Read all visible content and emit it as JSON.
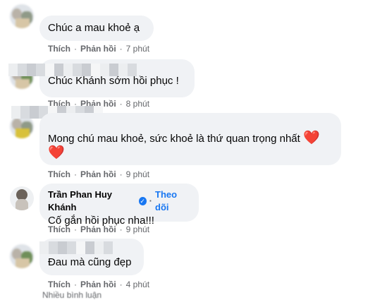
{
  "comments": [
    {
      "text": "Chúc a mau khoẻ ạ",
      "like": "Thích",
      "reply": "Phản hồi",
      "time": "7 phút"
    },
    {
      "text": "Chúc Khánh sớm hồi phục !",
      "like": "Thích",
      "reply": "Phản hồi",
      "time": "8 phút"
    },
    {
      "text": "Mong chú mau khoẻ, sức khoẻ là thứ quan trọng nhất",
      "emoji": "❤️",
      "emoji2": "❤️",
      "like": "Thích",
      "reply": "Phản hồi",
      "time": "9 phút"
    },
    {
      "author": "Trần Phan Huy Khánh",
      "verified_mark": "✓",
      "follow": "Theo dõi",
      "text": "Cố gắn hồi phục nha!!!",
      "like": "Thích",
      "reply": "Phản hồi",
      "time": "9 phút"
    },
    {
      "text": "Đau mà cũng đẹp",
      "like": "Thích",
      "reply": "Phản hồi",
      "time": "4 phút"
    }
  ],
  "footer_text": "Nhiều bình luận",
  "separator": "·",
  "colors": {
    "bubble": "#f0f2f5",
    "link": "#1877f2",
    "heart": "#e41e3f",
    "meta": "#65676b"
  }
}
